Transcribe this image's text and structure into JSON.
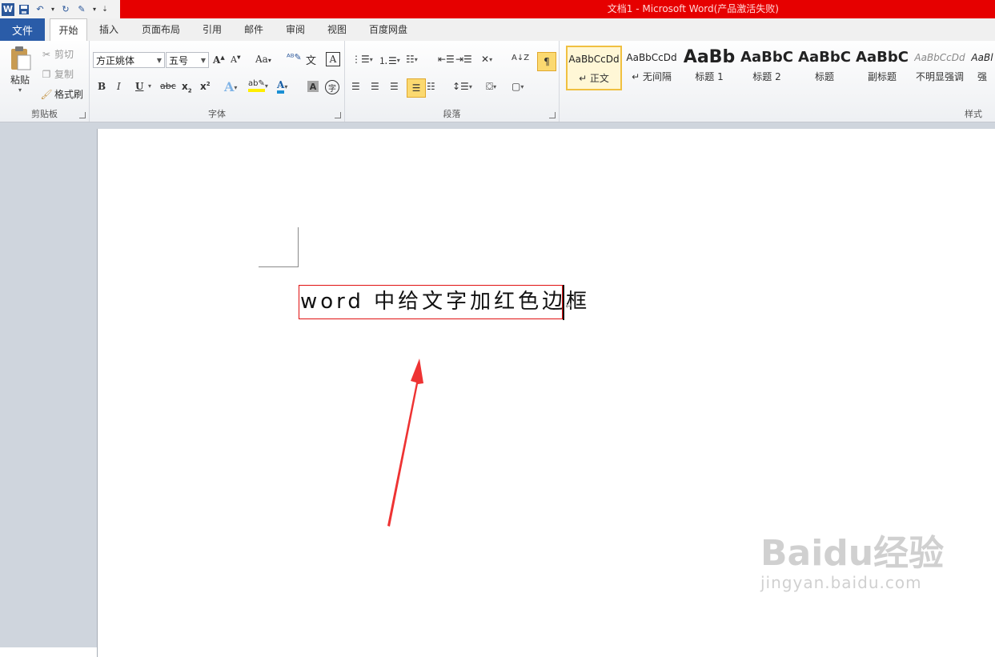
{
  "title": "文档1 - Microsoft Word(产品激活失败)",
  "tabs": [
    "文件",
    "开始",
    "插入",
    "页面布局",
    "引用",
    "邮件",
    "审阅",
    "视图",
    "百度网盘"
  ],
  "clipboard": {
    "paste": "粘贴",
    "cut": "剪切",
    "copy": "复制",
    "format_painter": "格式刷",
    "label": "剪贴板"
  },
  "font": {
    "family": "方正姚体",
    "size": "五号",
    "label": "字体"
  },
  "paragraph": {
    "label": "段落"
  },
  "styles": {
    "label": "样式",
    "items": [
      {
        "preview": "AaBbCcDd",
        "name": "↵ 正文"
      },
      {
        "preview": "AaBbCcDd",
        "name": "↵ 无间隔"
      },
      {
        "preview": "AaBb",
        "name": "标题 1"
      },
      {
        "preview": "AaBbC",
        "name": "标题 2"
      },
      {
        "preview": "AaBbC",
        "name": "标题"
      },
      {
        "preview": "AaBbC",
        "name": "副标题"
      },
      {
        "preview": "AaBbCcDd",
        "name": "不明显强调"
      },
      {
        "preview": "AaBl",
        "name": "强"
      }
    ]
  },
  "document": {
    "text": "word 中给文字加红色边框",
    "pilcrow": "↵"
  },
  "watermark": {
    "brand": "Baidu经验",
    "url": "jingyan.baidu.com"
  },
  "colors": {
    "title_bar": "#e60000",
    "file_tab": "#2a5ca8",
    "text_border": "#e01010",
    "arrow": "#ee3333"
  }
}
